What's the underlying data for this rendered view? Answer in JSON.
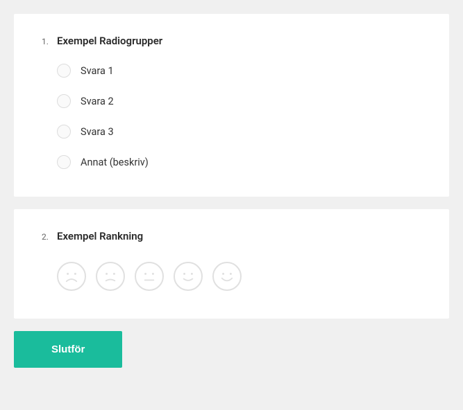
{
  "q1": {
    "number": "1.",
    "title": "Exempel Radiogrupper",
    "options": [
      "Svara 1",
      "Svara 2",
      "Svara 3",
      "Annat (beskriv)"
    ]
  },
  "q2": {
    "number": "2.",
    "title": "Exempel Rankning"
  },
  "submit_label": "Slutför"
}
